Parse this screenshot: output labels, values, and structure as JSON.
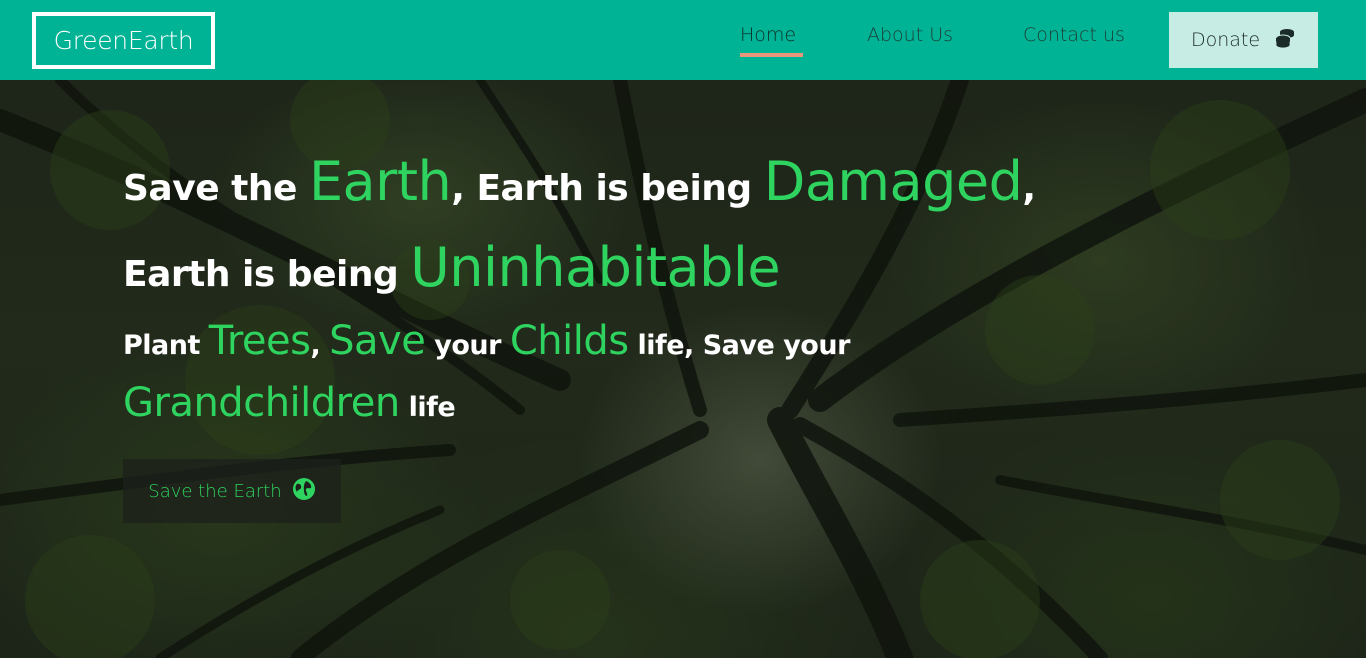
{
  "brand": {
    "name": "GreenEarth"
  },
  "nav": {
    "home": "Home",
    "about": "About Us",
    "contact": "Contact us",
    "donate": "Donate",
    "donate_icon": "coins-icon"
  },
  "hero": {
    "line1": {
      "a": "Save the ",
      "b": "Earth",
      "c": ", Earth is being ",
      "d": "Damaged",
      "e": ","
    },
    "line2": {
      "a": "Earth is being ",
      "b": "Uninhabitable"
    },
    "line3": {
      "a": "Plant ",
      "b": "Trees",
      "c": ", ",
      "d": "Save",
      "e": " your ",
      "f": "Childs",
      "g": " life, Save your"
    },
    "line4": {
      "a": "Grandchildren",
      "b": " life"
    },
    "cta": "Save the Earth",
    "cta_icon": "globe-icon"
  },
  "colors": {
    "navbar": "#00b395",
    "accent_green": "#2ed45f",
    "active_underline": "#e9967a",
    "donate_bg": "#c7ece4"
  }
}
